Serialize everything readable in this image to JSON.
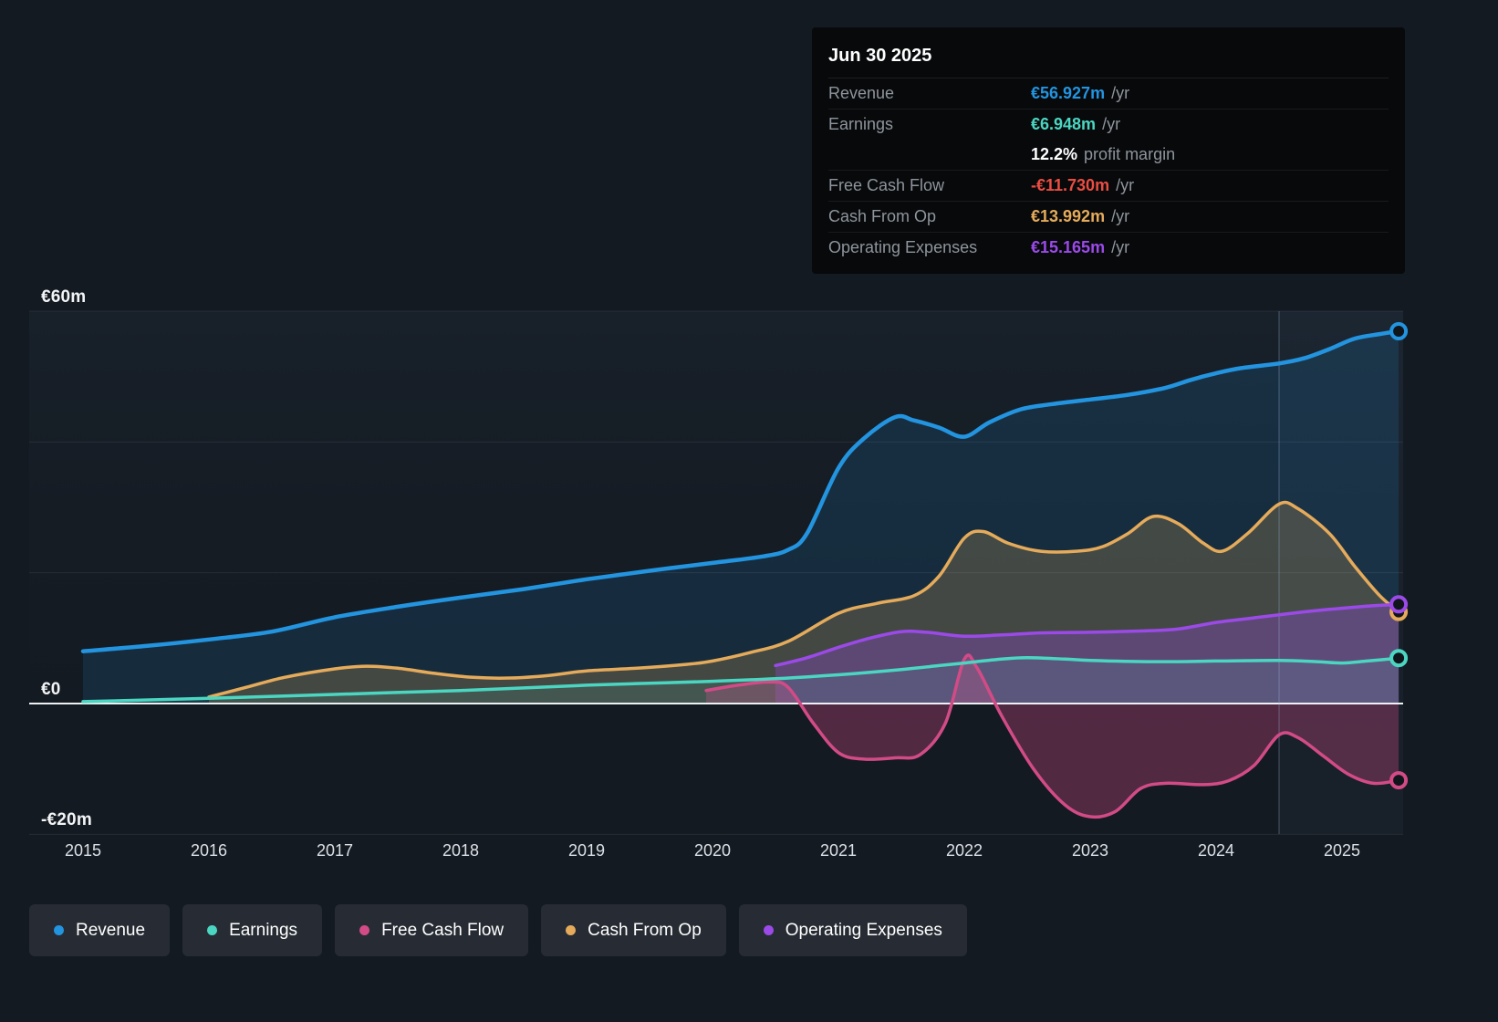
{
  "tooltip": {
    "title": "Jun 30 2025",
    "rows": [
      {
        "label": "Revenue",
        "value": "€56.927m",
        "suffix": "/yr",
        "value_color": "#2394df",
        "separator": false
      },
      {
        "label": "Earnings",
        "value": "€6.948m",
        "suffix": "/yr",
        "value_color": "#4bd6c2",
        "separator": true
      },
      {
        "label": "",
        "value": "12.2%",
        "suffix": "profit margin",
        "value_color": "#ffffff",
        "separator": false
      },
      {
        "label": "Free Cash Flow",
        "value": "-€11.730m",
        "suffix": "/yr",
        "value_color": "#eb4d42",
        "separator": true
      },
      {
        "label": "Cash From Op",
        "value": "€13.992m",
        "suffix": "/yr",
        "value_color": "#e5ab5b",
        "separator": true
      },
      {
        "label": "Operating Expenses",
        "value": "€15.165m",
        "suffix": "/yr",
        "value_color": "#9b4ae8",
        "separator": true
      }
    ]
  },
  "legend": {
    "items": [
      {
        "label": "Revenue",
        "color": "#2394df"
      },
      {
        "label": "Earnings",
        "color": "#4bd6c2"
      },
      {
        "label": "Free Cash Flow",
        "color": "#d24b86"
      },
      {
        "label": "Cash From Op",
        "color": "#e5ab5b"
      },
      {
        "label": "Operating Expenses",
        "color": "#9b4ae8"
      }
    ]
  },
  "chart_data": {
    "type": "area",
    "x_unit": "year",
    "y_unit": "EUR millions",
    "x_range": [
      2015,
      2025.5
    ],
    "y_range": [
      -20,
      60
    ],
    "y_gridlines": [
      60,
      40,
      20,
      0,
      -20
    ],
    "y_ticks": [
      {
        "label": "€60m",
        "value": 60
      },
      {
        "label": "€0",
        "value": 0
      },
      {
        "label": "-€20m",
        "value": -20
      }
    ],
    "x_ticks": [
      2015,
      2016,
      2017,
      2018,
      2019,
      2020,
      2021,
      2022,
      2023,
      2024,
      2025
    ],
    "highlight_start_x": 2024.5,
    "series": [
      {
        "name": "Revenue",
        "color": "#2394df",
        "points": [
          [
            2015,
            8
          ],
          [
            2015.5,
            8.8
          ],
          [
            2016,
            9.8
          ],
          [
            2016.5,
            11
          ],
          [
            2017,
            13.2
          ],
          [
            2017.5,
            14.8
          ],
          [
            2018,
            16.2
          ],
          [
            2018.5,
            17.5
          ],
          [
            2019,
            19
          ],
          [
            2019.5,
            20.3
          ],
          [
            2020,
            21.5
          ],
          [
            2020.4,
            22.5
          ],
          [
            2020.6,
            23.5
          ],
          [
            2020.75,
            26
          ],
          [
            2021,
            36
          ],
          [
            2021.2,
            40.5
          ],
          [
            2021.45,
            43.8
          ],
          [
            2021.6,
            43.3
          ],
          [
            2021.8,
            42.2
          ],
          [
            2022,
            40.8
          ],
          [
            2022.2,
            43
          ],
          [
            2022.45,
            45
          ],
          [
            2022.7,
            45.8
          ],
          [
            2023,
            46.5
          ],
          [
            2023.3,
            47.2
          ],
          [
            2023.6,
            48.3
          ],
          [
            2023.8,
            49.5
          ],
          [
            2024,
            50.5
          ],
          [
            2024.2,
            51.3
          ],
          [
            2024.5,
            52
          ],
          [
            2024.7,
            52.8
          ],
          [
            2024.9,
            54.2
          ],
          [
            2025.1,
            55.8
          ],
          [
            2025.3,
            56.5
          ],
          [
            2025.45,
            56.93
          ]
        ]
      },
      {
        "name": "Earnings",
        "color": "#4bd6c2",
        "points": [
          [
            2015,
            0.3
          ],
          [
            2016,
            0.8
          ],
          [
            2017,
            1.4
          ],
          [
            2018,
            2
          ],
          [
            2019,
            2.8
          ],
          [
            2019.5,
            3.1
          ],
          [
            2020,
            3.4
          ],
          [
            2020.5,
            3.8
          ],
          [
            2021,
            4.4
          ],
          [
            2021.5,
            5.2
          ],
          [
            2021.8,
            5.8
          ],
          [
            2022,
            6.2
          ],
          [
            2022.3,
            6.8
          ],
          [
            2022.5,
            7
          ],
          [
            2022.8,
            6.8
          ],
          [
            2023,
            6.6
          ],
          [
            2023.5,
            6.4
          ],
          [
            2024,
            6.5
          ],
          [
            2024.5,
            6.6
          ],
          [
            2024.8,
            6.4
          ],
          [
            2025,
            6.2
          ],
          [
            2025.2,
            6.5
          ],
          [
            2025.45,
            6.95
          ]
        ]
      },
      {
        "name": "Free Cash Flow",
        "color": "#d24b86",
        "points": [
          [
            2019.95,
            2
          ],
          [
            2020.2,
            2.8
          ],
          [
            2020.45,
            3.3
          ],
          [
            2020.6,
            2.5
          ],
          [
            2020.8,
            -3
          ],
          [
            2021,
            -7.5
          ],
          [
            2021.2,
            -8.5
          ],
          [
            2021.45,
            -8.3
          ],
          [
            2021.65,
            -7.8
          ],
          [
            2021.85,
            -3
          ],
          [
            2022,
            6.8
          ],
          [
            2022.1,
            5.5
          ],
          [
            2022.3,
            -2
          ],
          [
            2022.55,
            -10
          ],
          [
            2022.8,
            -15.5
          ],
          [
            2023,
            -17.3
          ],
          [
            2023.2,
            -16.5
          ],
          [
            2023.4,
            -13
          ],
          [
            2023.6,
            -12.2
          ],
          [
            2023.9,
            -12.4
          ],
          [
            2024.1,
            -11.8
          ],
          [
            2024.3,
            -9.5
          ],
          [
            2024.5,
            -4.8
          ],
          [
            2024.65,
            -5.2
          ],
          [
            2024.85,
            -8
          ],
          [
            2025.05,
            -10.8
          ],
          [
            2025.25,
            -12.2
          ],
          [
            2025.45,
            -11.73
          ]
        ]
      },
      {
        "name": "Cash From Op",
        "color": "#e5ab5b",
        "points": [
          [
            2016,
            1
          ],
          [
            2016.3,
            2.5
          ],
          [
            2016.6,
            4
          ],
          [
            2017,
            5.3
          ],
          [
            2017.25,
            5.7
          ],
          [
            2017.5,
            5.4
          ],
          [
            2017.8,
            4.6
          ],
          [
            2018.1,
            4
          ],
          [
            2018.4,
            3.9
          ],
          [
            2018.7,
            4.3
          ],
          [
            2019,
            5
          ],
          [
            2019.4,
            5.4
          ],
          [
            2019.8,
            6
          ],
          [
            2020,
            6.5
          ],
          [
            2020.3,
            7.8
          ],
          [
            2020.6,
            9.5
          ],
          [
            2021,
            13.8
          ],
          [
            2021.3,
            15.3
          ],
          [
            2021.6,
            16.5
          ],
          [
            2021.8,
            19.5
          ],
          [
            2022,
            25.3
          ],
          [
            2022.15,
            26.3
          ],
          [
            2022.35,
            24.5
          ],
          [
            2022.6,
            23.3
          ],
          [
            2022.9,
            23.3
          ],
          [
            2023.1,
            24
          ],
          [
            2023.3,
            26
          ],
          [
            2023.5,
            28.6
          ],
          [
            2023.7,
            27.5
          ],
          [
            2023.9,
            24.5
          ],
          [
            2024.05,
            23.3
          ],
          [
            2024.25,
            26
          ],
          [
            2024.5,
            30.5
          ],
          [
            2024.65,
            29.8
          ],
          [
            2024.9,
            26
          ],
          [
            2025.1,
            21
          ],
          [
            2025.3,
            16.5
          ],
          [
            2025.45,
            14
          ]
        ]
      },
      {
        "name": "Operating Expenses",
        "color": "#9b4ae8",
        "points": [
          [
            2020.5,
            5.8
          ],
          [
            2020.75,
            7
          ],
          [
            2021,
            8.6
          ],
          [
            2021.25,
            10
          ],
          [
            2021.5,
            11
          ],
          [
            2021.7,
            10.9
          ],
          [
            2022,
            10.3
          ],
          [
            2022.3,
            10.5
          ],
          [
            2022.6,
            10.8
          ],
          [
            2023,
            10.9
          ],
          [
            2023.4,
            11.1
          ],
          [
            2023.7,
            11.4
          ],
          [
            2024,
            12.4
          ],
          [
            2024.3,
            13.1
          ],
          [
            2024.6,
            13.8
          ],
          [
            2024.9,
            14.4
          ],
          [
            2025.2,
            14.9
          ],
          [
            2025.45,
            15.17
          ]
        ]
      }
    ]
  }
}
